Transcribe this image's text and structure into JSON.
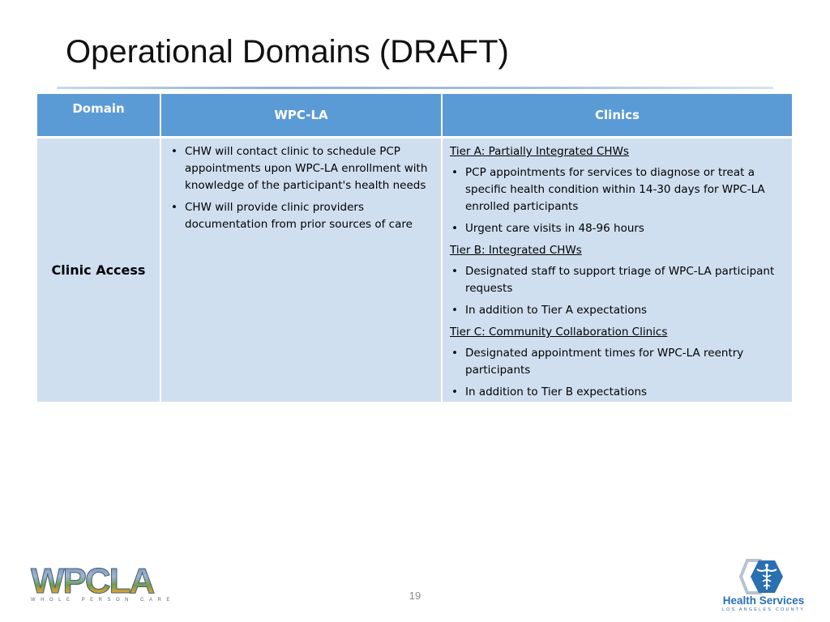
{
  "slide": {
    "title": "Operational Domains (DRAFT)",
    "page_number": "19"
  },
  "table": {
    "headers": [
      "Domain",
      "WPC-LA",
      "Clinics"
    ],
    "rows": [
      {
        "domain": "Clinic Access",
        "wpc_la": [
          "CHW will contact clinic to schedule PCP appointments upon WPC-LA enrollment with knowledge of the participant's health needs",
          "CHW will provide clinic providers documentation from prior sources of care"
        ],
        "clinics": [
          {
            "tier": "Tier A: Partially Integrated CHWs",
            "items": [
              "PCP appointments for services to diagnose or treat a specific health condition within 14-30 days for WPC-LA enrolled participants",
              "Urgent care visits in 48-96 hours"
            ]
          },
          {
            "tier": "Tier B: Integrated CHWs",
            "items": [
              "Designated staff to support triage of WPC-LA participant requests",
              "In addition to Tier A expectations"
            ]
          },
          {
            "tier": "Tier C: Community Collaboration Clinics",
            "items": [
              "Designated appointment times for WPC-LA reentry participants",
              "In addition to Tier B expectations"
            ]
          }
        ]
      }
    ]
  },
  "bullet_glyph": "•",
  "logos": {
    "left": {
      "letters": "WPCLA",
      "tagline": "WHOLE PERSON CARE"
    },
    "right": {
      "brand": "Health Services",
      "sub": "LOS ANGELES COUNTY",
      "emblem": "caduceus-hexagon-icon"
    }
  },
  "colors": {
    "header_bg": "#5b9bd5",
    "body_bg": "#d0dff0",
    "brand_blue": "#2a6fb0"
  }
}
